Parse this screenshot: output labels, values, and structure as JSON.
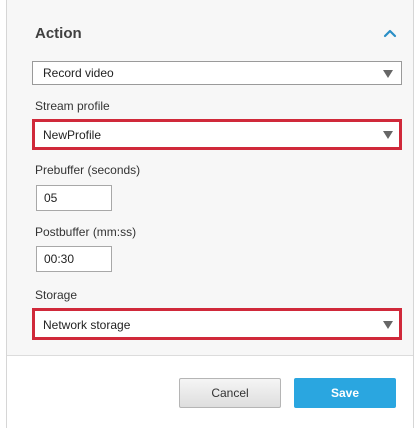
{
  "action_section": {
    "title": "Action",
    "collapse_icon": "chevron-up-icon",
    "action_select": {
      "value": "Record video"
    },
    "stream_profile": {
      "label": "Stream profile",
      "value": "NewProfile"
    },
    "prebuffer": {
      "label": "Prebuffer (seconds)",
      "value": "05"
    },
    "postbuffer": {
      "label": "Postbuffer (mm:ss)",
      "value": "00:30"
    },
    "storage": {
      "label": "Storage",
      "value": "Network storage"
    },
    "highlight_color": "#d0293a"
  },
  "footer": {
    "cancel_label": "Cancel",
    "save_label": "Save",
    "save_color": "#2aa6e0"
  }
}
